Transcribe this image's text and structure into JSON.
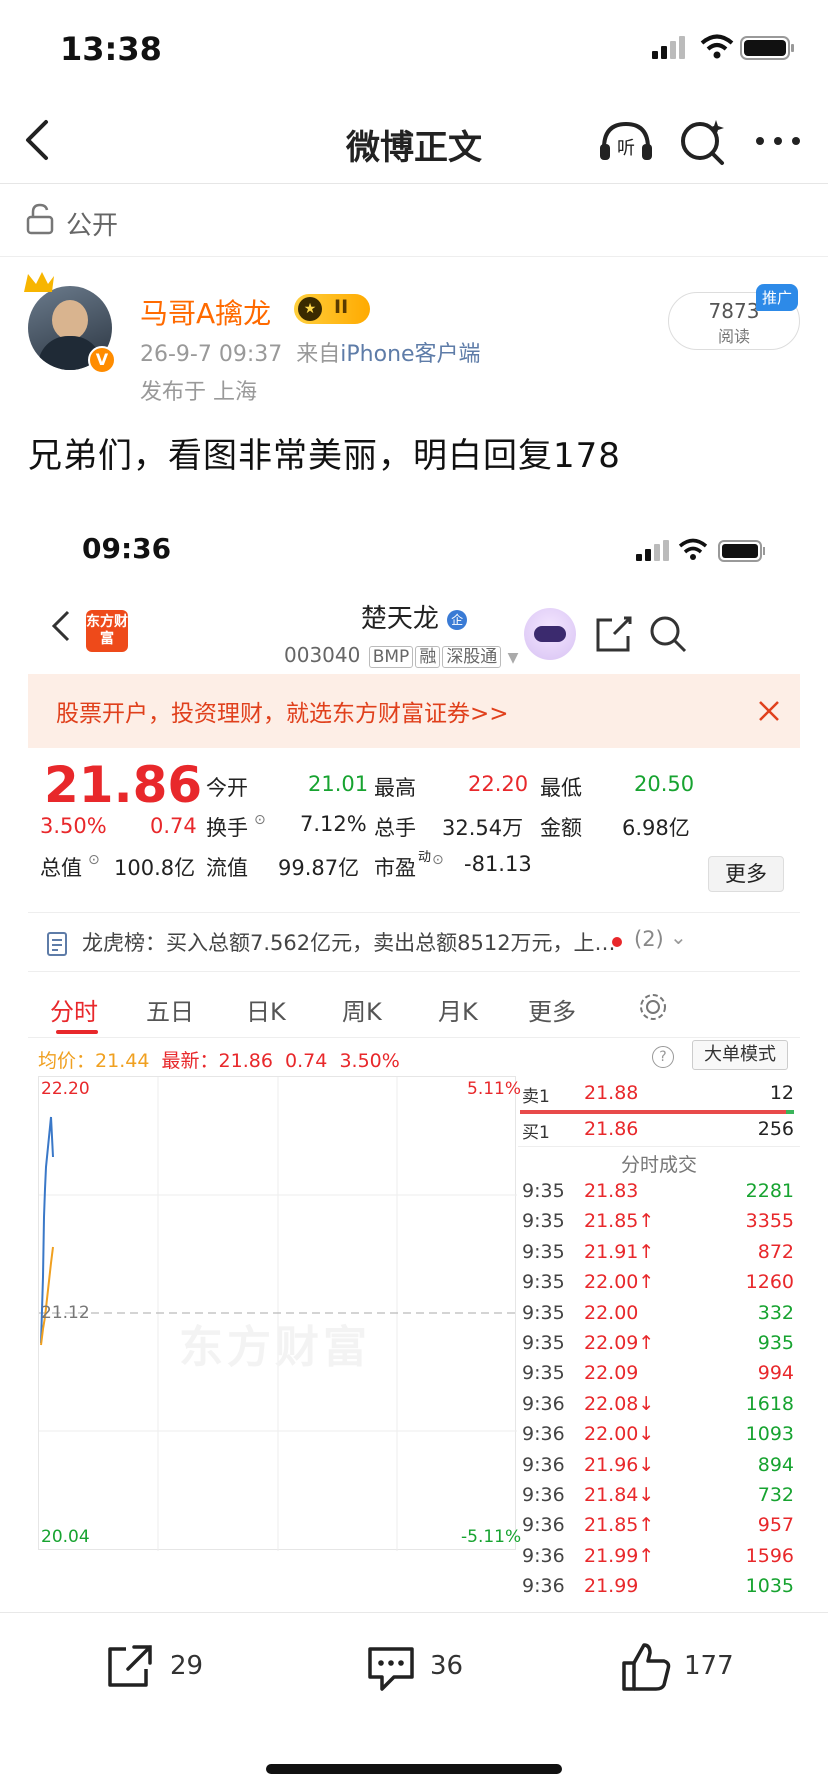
{
  "status": {
    "time": "13:38"
  },
  "nav": {
    "title": "微博正文"
  },
  "visibility": {
    "label": "公开"
  },
  "author": {
    "name": "马哥A擒龙",
    "level_badge": "II",
    "time": "26-9-7 09:37",
    "from_prefix": "来自",
    "source": "iPhone客户端",
    "location": "发布于 上海"
  },
  "reads": {
    "count": "7873",
    "label": "阅读",
    "promo": "推广"
  },
  "post": {
    "text": "兄弟们，看图非常美丽，明白回复178"
  },
  "shot": {
    "time": "09:36",
    "stock_name": "楚天龙",
    "stock_code": "003040",
    "tags": [
      "BMP",
      "融",
      "深股通"
    ],
    "app_logo": "东方财富",
    "ad_text": "股票开户，投资理财，就选东方财富证券>>",
    "price": "21.86",
    "change_pct": "3.50%",
    "change": "0.74",
    "fields": [
      {
        "label": "今开",
        "value": "21.01",
        "color": "#17a330"
      },
      {
        "label": "最高",
        "value": "22.20",
        "color": "#e8282b"
      },
      {
        "label": "最低",
        "value": "20.50",
        "color": "#17a330"
      },
      {
        "label": "换手",
        "value": "7.12%",
        "color": "#222222"
      },
      {
        "label": "总手",
        "value": "32.54万",
        "color": "#222222"
      },
      {
        "label": "金额",
        "value": "6.98亿",
        "color": "#222222"
      },
      {
        "label": "总值",
        "value": "100.8亿",
        "color": "#222222"
      },
      {
        "label": "流值",
        "value": "99.87亿",
        "color": "#222222"
      },
      {
        "label": "市盈",
        "value": "-81.13",
        "color": "#222222"
      }
    ],
    "pe_suffix": "动",
    "more_label": "更多",
    "lhb_text": "龙虎榜：买入总额7.562亿元，卖出总额8512万元，上…",
    "lhb_count": "(2)",
    "tabs": [
      "分时",
      "五日",
      "日K",
      "周K",
      "月K",
      "更多"
    ],
    "avg_label": "均价：",
    "avg_value": "21.44",
    "latest_label": "最新：",
    "latest_value": "21.86",
    "latest_change": "0.74",
    "latest_pct": "3.50%",
    "big_order_label": "大单模式",
    "chart": {
      "y_top": "22.20",
      "y_mid": "21.12",
      "y_bot": "20.04",
      "pct_top": "5.11%",
      "pct_bot": "-5.11%",
      "watermark": "东方财富"
    },
    "ask1": {
      "label": "卖1",
      "price": "21.88",
      "vol": "12"
    },
    "bid1": {
      "label": "买1",
      "price": "21.86",
      "vol": "256"
    },
    "ticks_title": "分时成交",
    "ticks": [
      {
        "t": "9:35",
        "p": "21.83",
        "v": "2281",
        "vc": "#17a330"
      },
      {
        "t": "9:35",
        "p": "21.85↑",
        "v": "3355",
        "vc": "#e8282b"
      },
      {
        "t": "9:35",
        "p": "21.91↑",
        "v": "872",
        "vc": "#e8282b"
      },
      {
        "t": "9:35",
        "p": "22.00↑",
        "v": "1260",
        "vc": "#e8282b"
      },
      {
        "t": "9:35",
        "p": "22.00",
        "v": "332",
        "vc": "#17a330"
      },
      {
        "t": "9:35",
        "p": "22.09↑",
        "v": "935",
        "vc": "#17a330"
      },
      {
        "t": "9:35",
        "p": "22.09",
        "v": "994",
        "vc": "#e8282b"
      },
      {
        "t": "9:36",
        "p": "22.08↓",
        "v": "1618",
        "vc": "#17a330"
      },
      {
        "t": "9:36",
        "p": "22.00↓",
        "v": "1093",
        "vc": "#17a330"
      },
      {
        "t": "9:36",
        "p": "21.96↓",
        "v": "894",
        "vc": "#17a330"
      },
      {
        "t": "9:36",
        "p": "21.84↓",
        "v": "732",
        "vc": "#17a330"
      },
      {
        "t": "9:36",
        "p": "21.85↑",
        "v": "957",
        "vc": "#e8282b"
      },
      {
        "t": "9:36",
        "p": "21.99↑",
        "v": "1596",
        "vc": "#e8282b"
      },
      {
        "t": "9:36",
        "p": "21.99",
        "v": "1035",
        "vc": "#17a330"
      }
    ]
  },
  "actions": {
    "repost": "29",
    "comment": "36",
    "like": "177"
  }
}
